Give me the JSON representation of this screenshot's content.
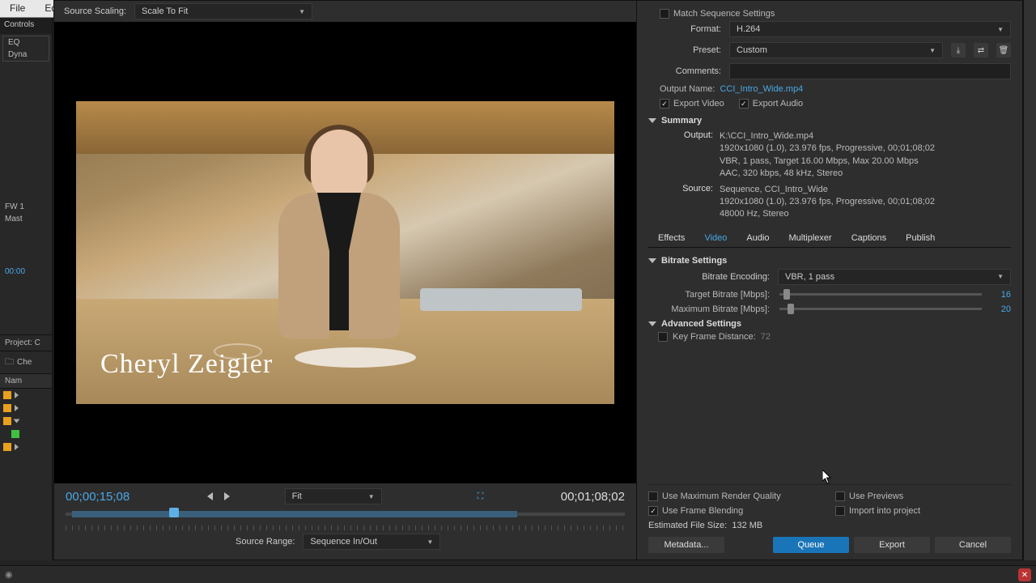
{
  "menu": {
    "file": "File",
    "edit": "Edit"
  },
  "left": {
    "controls_tab": "Controls",
    "eq": "EQ",
    "dyna": "Dyna",
    "fw": "FW 1",
    "mast": "Mast",
    "tc": "00:00",
    "project": "Project: C",
    "search_placeholder": "Che",
    "name_col": "Nam"
  },
  "preview": {
    "scaling_label": "Source Scaling:",
    "scaling_value": "Scale To Fit",
    "lower_third": "Cheryl Zeigler",
    "tc_current": "00;00;15;08",
    "tc_total": "00;01;08;02",
    "fit_label": "Fit",
    "range_label": "Source Range:",
    "range_value": "Sequence In/Out"
  },
  "export": {
    "match_seq": "Match Sequence Settings",
    "format_label": "Format:",
    "format_value": "H.264",
    "preset_label": "Preset:",
    "preset_value": "Custom",
    "comments_label": "Comments:",
    "outname_label": "Output Name:",
    "outname_value": "CCI_Intro_Wide.mp4",
    "export_video": "Export Video",
    "export_audio": "Export Audio",
    "summary_title": "Summary",
    "summary": {
      "output_lbl": "Output:",
      "output_l1": "K:\\CCI_Intro_Wide.mp4",
      "output_l2": "1920x1080 (1.0), 23.976 fps, Progressive, 00;01;08;02",
      "output_l3": "VBR, 1 pass, Target 16.00 Mbps, Max 20.00 Mbps",
      "output_l4": "AAC, 320 kbps, 48 kHz, Stereo",
      "source_lbl": "Source:",
      "source_l1": "Sequence, CCI_Intro_Wide",
      "source_l2": "1920x1080 (1.0), 23.976 fps, Progressive, 00;01;08;02",
      "source_l3": "48000 Hz, Stereo"
    },
    "tabs": {
      "effects": "Effects",
      "video": "Video",
      "audio": "Audio",
      "mux": "Multiplexer",
      "captions": "Captions",
      "publish": "Publish"
    },
    "bitrate_title": "Bitrate Settings",
    "encoding_label": "Bitrate Encoding:",
    "encoding_value": "VBR, 1 pass",
    "target_label": "Target Bitrate [Mbps]:",
    "target_value": "16",
    "max_label": "Maximum Bitrate [Mbps]:",
    "max_value": "20",
    "advanced_title": "Advanced Settings",
    "keyframe_label": "Key Frame Distance:",
    "keyframe_value": "72",
    "max_render": "Use Maximum Render Quality",
    "use_previews": "Use Previews",
    "frame_blend": "Use Frame Blending",
    "import_proj": "Import into project",
    "est_label": "Estimated File Size:",
    "est_value": "132 MB",
    "metadata_btn": "Metadata...",
    "queue_btn": "Queue",
    "export_btn": "Export",
    "cancel_btn": "Cancel"
  },
  "colors": {
    "bin_orange": "#e8a020",
    "bin_green": "#40c040"
  }
}
